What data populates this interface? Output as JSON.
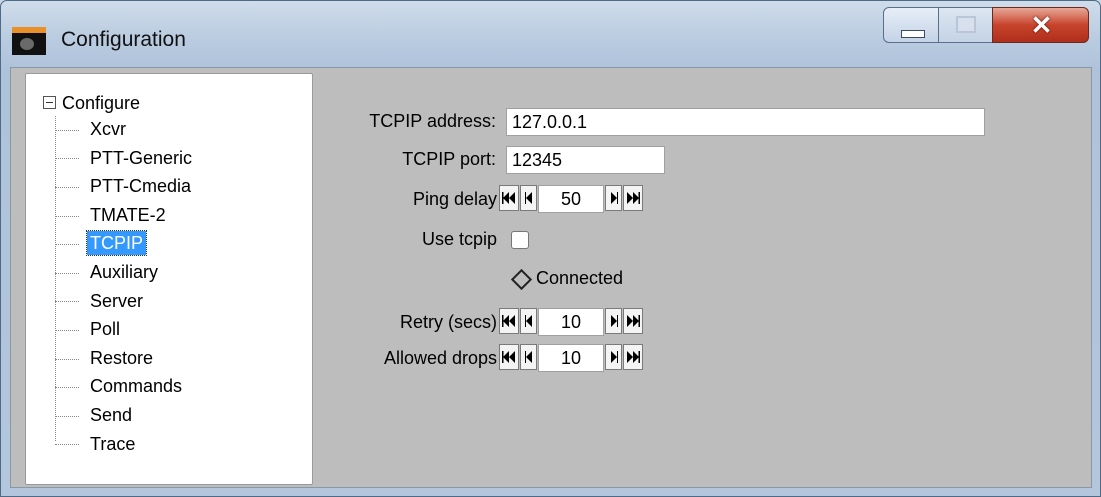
{
  "window": {
    "title": "Configuration"
  },
  "tree": {
    "root": "Configure",
    "items": [
      "Xcvr",
      "PTT-Generic",
      "PTT-Cmedia",
      "TMATE-2",
      "TCPIP",
      "Auxiliary",
      "Server",
      "Poll",
      "Restore",
      "Commands",
      "Send",
      "Trace"
    ],
    "selected": "TCPIP"
  },
  "form": {
    "tcpip_address_label": "TCPIP address:",
    "tcpip_address_value": "127.0.0.1",
    "tcpip_port_label": "TCPIP port:",
    "tcpip_port_value": "12345",
    "ping_delay_label": "Ping delay",
    "ping_delay_value": "50",
    "use_tcpip_label": "Use tcpip",
    "use_tcpip_checked": false,
    "connected_label": "Connected",
    "retry_label": "Retry (secs)",
    "retry_value": "10",
    "allowed_drops_label": "Allowed drops",
    "allowed_drops_value": "10"
  },
  "icons": {
    "app": "radio-transceiver-icon",
    "minimize": "minimize-icon",
    "maximize": "maximize-icon",
    "close": "close-icon",
    "spinner_fast_back": "double-left-arrow-icon",
    "spinner_back": "left-arrow-icon",
    "spinner_forward": "right-arrow-icon",
    "spinner_fast_forward": "double-right-arrow-icon"
  }
}
